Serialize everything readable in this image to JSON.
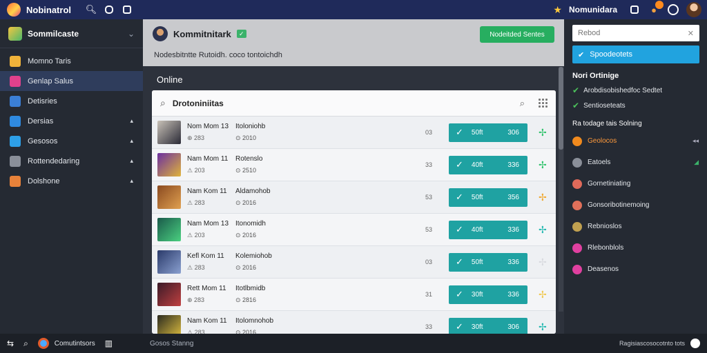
{
  "topbar": {
    "app_title": "Nobinatrol",
    "user_name": "Nomunidara",
    "notif_count": ""
  },
  "sidebar": {
    "header": "Sommilcaste",
    "items": [
      {
        "label": "Momno Taris",
        "color": "#f0b33a",
        "arrow": ""
      },
      {
        "label": "Genlap Salus",
        "color": "#e0418c",
        "arrow": ""
      },
      {
        "label": "Detisries",
        "color": "#3b7fd6",
        "arrow": ""
      },
      {
        "label": "Dersias",
        "color": "#2f8ae0",
        "arrow": "▴"
      },
      {
        "label": "Gesosos",
        "color": "#2ea0e8",
        "arrow": "▴"
      },
      {
        "label": "Rottendedaring",
        "color": "#8a8f99",
        "arrow": "▴"
      },
      {
        "label": "Dolshone",
        "color": "#e8823a",
        "arrow": "▴"
      }
    ]
  },
  "main": {
    "title": "Kommitnitark",
    "subtitle": "Nodesbitntte Rutoidh. coco tontoichdh",
    "header_button": "Nodeitded Sentes",
    "section_title": "Online",
    "search_value": "Drotoniniitas",
    "rows": [
      {
        "name": "Nom Mom 13",
        "meta": "⊕ 283",
        "desc": "Itoloniohb",
        "year": "⊙ 2010",
        "count": "03",
        "b1": "50ft",
        "b2": "306",
        "act": "✢",
        "act_color": "#2ec26a",
        "thumb": [
          "#c9c2b8",
          "#2a2a36"
        ]
      },
      {
        "name": "Nam Mom 11",
        "meta": "⚠ 203",
        "desc": "Rotenslo",
        "year": "⊙ 2510",
        "count": "33",
        "b1": "40ft",
        "b2": "336",
        "act": "✢",
        "act_color": "#2ec26a",
        "thumb": [
          "#6b2fa0",
          "#e0b43a"
        ]
      },
      {
        "name": "Nam Kom 11",
        "meta": "⚠ 283",
        "desc": "Aldamohob",
        "year": "⊙ 2016",
        "count": "53",
        "b1": "50ft",
        "b2": "356",
        "act": "✢",
        "act_color": "#f0a830",
        "thumb": [
          "#8a4a20",
          "#e0a050"
        ]
      },
      {
        "name": "Nam Mom 13",
        "meta": "⚠ 203",
        "desc": "Itonomidh",
        "year": "⊙ 2016",
        "count": "53",
        "b1": "40ft",
        "b2": "336",
        "act": "✢",
        "act_color": "#22b8b0",
        "thumb": [
          "#1a5a4a",
          "#4ad080"
        ]
      },
      {
        "name": "Kefl Kom 11",
        "meta": "⚠ 283",
        "desc": "Kolemiohob",
        "year": "⊙ 2016",
        "count": "03",
        "b1": "50ft",
        "b2": "336",
        "act": "✢",
        "act_color": "#d8dadf",
        "thumb": [
          "#2a3a6a",
          "#8aa0d0"
        ]
      },
      {
        "name": "Rett Mom 11",
        "meta": "⊕ 283",
        "desc": "Itotlbmidb",
        "year": "⊙ 2816",
        "count": "31",
        "b1": "30ft",
        "b2": "336",
        "act": "✢",
        "act_color": "#f0c850",
        "thumb": [
          "#3a1a28",
          "#c04040"
        ]
      },
      {
        "name": "Nam Kom 11",
        "meta": "⚠ 283",
        "desc": "Itolomnohob",
        "year": "⊙ 2016",
        "count": "33",
        "b1": "30ft",
        "b2": "306",
        "act": "✢",
        "act_color": "#22b8b0",
        "thumb": [
          "#2a2a20",
          "#e0c040"
        ]
      }
    ]
  },
  "right": {
    "search_placeholder": "Rebod",
    "selected": "Spoodeotets",
    "heading": "Nori Ortinige",
    "checks": [
      "Arobdisobishedfoc Sedtet",
      "Sentioseteats"
    ],
    "sub_heading": "Ra todage tais Solning",
    "items": [
      {
        "label": "Geolocos",
        "color": "#f08a1e",
        "trail": "◂◂",
        "hl": true
      },
      {
        "label": "Eatoels",
        "color": "#8a8f99",
        "trail": "◢",
        "hl": false
      },
      {
        "label": "Gornetiniating",
        "color": "#e06a5a",
        "trail": "",
        "hl": false
      },
      {
        "label": "Gonsoribotinemoing",
        "color": "#e0705a",
        "trail": "",
        "hl": false
      },
      {
        "label": "Rebnioslos",
        "color": "#c0a050",
        "trail": "",
        "hl": false
      },
      {
        "label": "Rlebonblols",
        "color": "#e040a0",
        "trail": "",
        "hl": false
      },
      {
        "label": "Deasenos",
        "color": "#e040a0",
        "trail": "",
        "hl": false
      }
    ]
  },
  "bottom": {
    "label": "Comutintsors",
    "status": "Gosos Stanng",
    "right_text": "Ragisiascosocotnto tots"
  }
}
